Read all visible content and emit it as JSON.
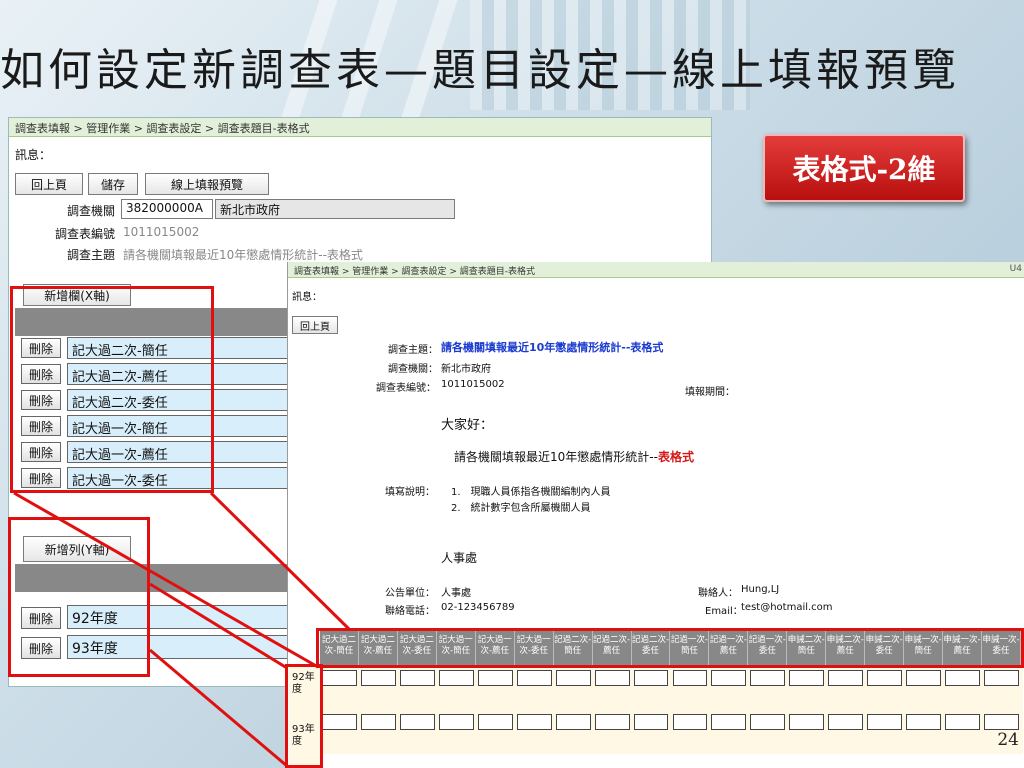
{
  "slide": {
    "title": "如何設定新調查表—題目設定—線上填報預覽",
    "badge": "表格式-2維",
    "page_number": "24"
  },
  "editor": {
    "breadcrumb": "調查表填報 > 管理作業 > 調查表設定 > 調查表題目-表格式",
    "info_label": "訊息：",
    "buttons": {
      "back": "回上頁",
      "save": "儲存",
      "preview": "線上填報預覽"
    },
    "fields": {
      "agency_label": "調查機關",
      "agency_code": "382000000A",
      "agency_name": "新北市政府",
      "survey_no_label": "調查表編號",
      "survey_no_value": "1011015002",
      "subject_label": "調查主題",
      "subject_value": "請各機關填報最近10年懲處情形統計--表格式"
    },
    "x_axis": {
      "add_button": "新增欄(X軸)",
      "delete_label": "刪除",
      "items": [
        "記大過二次-簡任",
        "記大過二次-薦任",
        "記大過二次-委任",
        "記大過一次-簡任",
        "記大過一次-薦任",
        "記大過一次-委任"
      ]
    },
    "y_axis": {
      "add_button": "新增列(Y軸)",
      "delete_label": "刪除",
      "items": [
        "92年度",
        "93年度"
      ]
    }
  },
  "preview": {
    "breadcrumb": "調查表填報 > 管理作業 > 調查表設定 > 調查表題目-表格式",
    "corner": "U4",
    "info_label": "訊息：",
    "back_button": "回上頁",
    "subject_label": "調查主題：",
    "subject_value": "請各機關填報最近10年懲處情形統計--表格式",
    "agency_label": "調查機關：",
    "agency_value": "新北市政府",
    "survey_no_label": "調查表編號：",
    "survey_no_value": "1011015002",
    "period_label": "填報期間：",
    "greeting": "大家好：",
    "intro_text": "請各機關填報最近10年懲處情形統計--",
    "intro_highlight": "表格式",
    "instructions_label": "填寫說明：",
    "instructions": [
      "1.　現職人員係指各機關編制內人員",
      "2.　統計數字包含所屬機關人員"
    ],
    "department": "人事處",
    "announce_unit_label": "公告單位：",
    "announce_unit_value": "人事處",
    "phone_label": "聯絡電話：",
    "phone_value": "02-123456789",
    "contact_label": "聯絡人：",
    "contact_value": "Hung,LJ",
    "email_label": "Email：",
    "email_value": "test@hotmail.com",
    "columns": [
      "記大過二次-簡任",
      "記大過二次-薦任",
      "記大過二次-委任",
      "記大過一次-簡任",
      "記大過一次-薦任",
      "記大過一次-委任",
      "記過二次-簡任",
      "記過二次-薦任",
      "記過二次-委任",
      "記過一次-簡任",
      "記過一次-薦任",
      "記過一次-委任",
      "申誡二次-簡任",
      "申誡二次-薦任",
      "申誡二次-委任",
      "申誡一次-簡任",
      "申誡一次-薦任",
      "申誡一次-委任"
    ],
    "rows": [
      "92年度",
      "93年度"
    ]
  },
  "colors": {
    "highlight_border": "#e01010",
    "badge_bg": "#c81d1d",
    "input_bg": "#d8eefa",
    "header_bg": "#888888",
    "breadcrumb_bg": "#e2f0d9",
    "subject_blue": "#1c3bd1"
  }
}
